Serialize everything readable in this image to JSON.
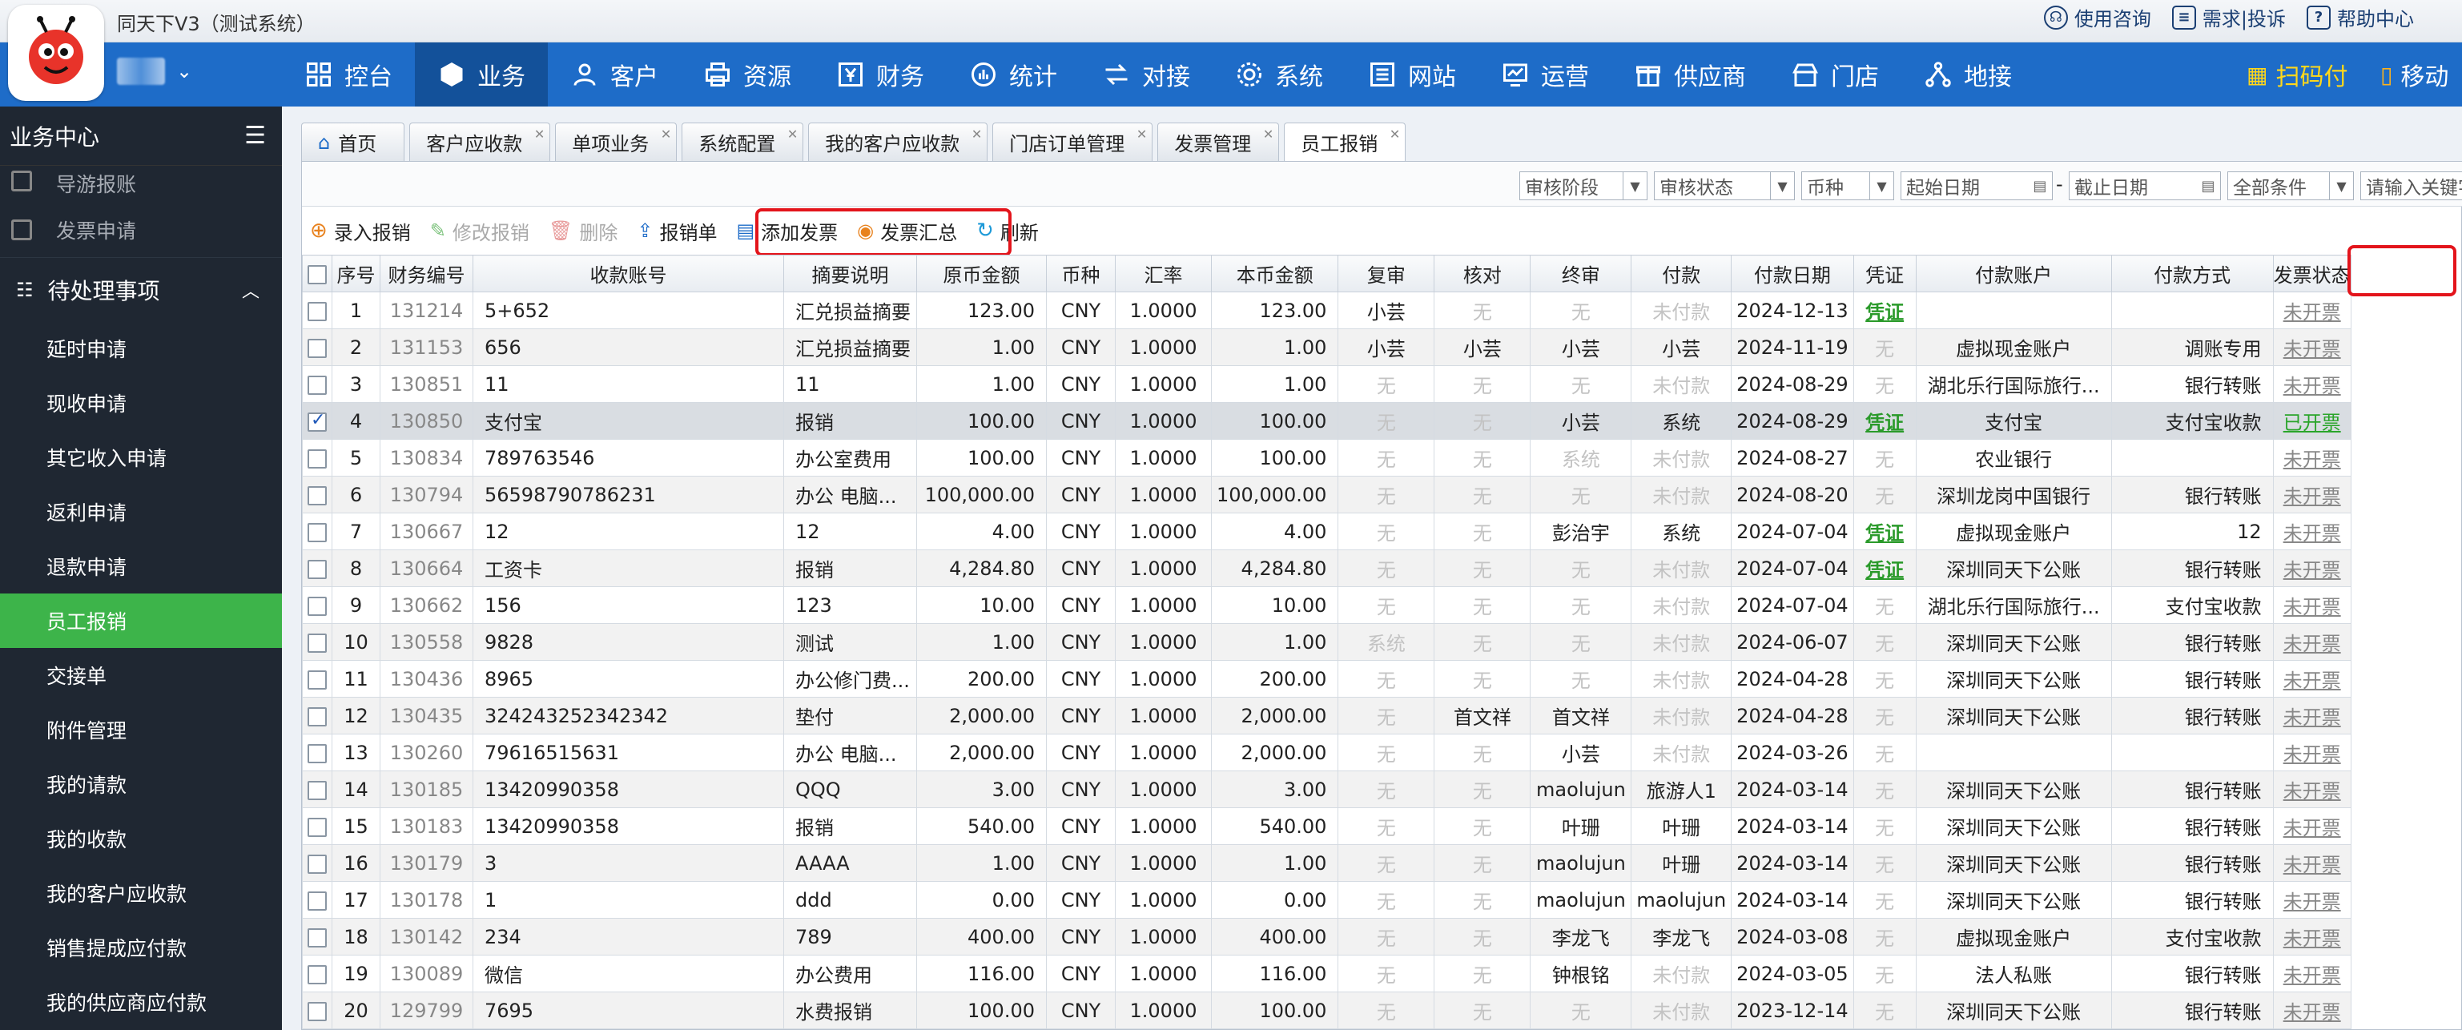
{
  "app_title": "同天下V3（测试系统）",
  "top_links": [
    "使用咨询",
    "需求|投诉",
    "帮助中心"
  ],
  "nav": [
    "控台",
    "业务",
    "客户",
    "资源",
    "财务",
    "统计",
    "对接",
    "系统",
    "网站",
    "运营",
    "供应商",
    "门店",
    "地接"
  ],
  "nav_active": "业务",
  "scan_label": "扫码付",
  "mobile_label": "移动",
  "sidebar": {
    "title": "业务中心",
    "top_items": [
      "导游报账",
      "发票申请"
    ],
    "group": "待处理事项",
    "sub_items": [
      "延时申请",
      "现收申请",
      "其它收入申请",
      "返利申请",
      "退款申请",
      "员工报销",
      "交接单",
      "附件管理",
      "我的请款",
      "我的收款",
      "我的客户应收款",
      "销售提成应付款",
      "我的供应商应付款"
    ],
    "active": "员工报销"
  },
  "tabs": [
    "首页",
    "客户应收款",
    "单项业务",
    "系统配置",
    "我的客户应收款",
    "门店订单管理",
    "发票管理",
    "员工报销"
  ],
  "active_tab": "员工报销",
  "filters": {
    "stage": "审核阶段",
    "status": "审核状态",
    "currency": "币种",
    "start_date": "起始日期",
    "dash": "-",
    "end_date": "截止日期",
    "all": "全部条件",
    "keyword": "请输入关键字"
  },
  "toolbar": [
    "录入报销",
    "修改报销",
    "删除",
    "报销单",
    "添加发票",
    "发票汇总",
    "刷新"
  ],
  "columns": [
    "序号",
    "财务编号",
    "收款账号",
    "摘要说明",
    "原币金额",
    "币种",
    "汇率",
    "本币金额",
    "复审",
    "核对",
    "终审",
    "付款",
    "付款日期",
    "凭证",
    "付款账户",
    "付款方式",
    "发票状态"
  ],
  "rows": [
    [
      "1",
      "131214",
      "5+652",
      "汇兑损益摘要",
      "123.00",
      "CNY",
      "1.0000",
      "123.00",
      "小芸",
      "无",
      "无",
      "未付款",
      "2024-12-13",
      "凭证",
      "",
      "",
      "未开票"
    ],
    [
      "2",
      "131153",
      "656",
      "汇兑损益摘要",
      "1.00",
      "CNY",
      "1.0000",
      "1.00",
      "小芸",
      "小芸",
      "小芸",
      "小芸",
      "2024-11-19",
      "无",
      "虚拟现金账户",
      "调账专用",
      "未开票"
    ],
    [
      "3",
      "130851",
      "11",
      "11",
      "1.00",
      "CNY",
      "1.0000",
      "1.00",
      "无",
      "无",
      "无",
      "未付款",
      "2024-08-29",
      "无",
      "湖北乐行国际旅行...",
      "银行转账",
      "未开票"
    ],
    [
      "4",
      "130850",
      "支付宝",
      "报销",
      "100.00",
      "CNY",
      "1.0000",
      "100.00",
      "无",
      "无",
      "小芸",
      "系统",
      "2024-08-29",
      "凭证",
      "支付宝",
      "支付宝收款",
      "已开票"
    ],
    [
      "5",
      "130834",
      "789763546",
      "办公室费用",
      "100.00",
      "CNY",
      "1.0000",
      "100.00",
      "无",
      "无",
      "系统",
      "未付款",
      "2024-08-27",
      "无",
      "农业银行",
      "",
      "未开票"
    ],
    [
      "6",
      "130794",
      "56598790786231",
      "办公 电脑...",
      "100,000.00",
      "CNY",
      "1.0000",
      "100,000.00",
      "无",
      "无",
      "无",
      "未付款",
      "2024-08-20",
      "无",
      "深圳龙岗中国银行",
      "银行转账",
      "未开票"
    ],
    [
      "7",
      "130667",
      "12",
      "12",
      "4.00",
      "CNY",
      "1.0000",
      "4.00",
      "无",
      "无",
      "彭治宇",
      "系统",
      "2024-07-04",
      "凭证",
      "虚拟现金账户",
      "12",
      "未开票"
    ],
    [
      "8",
      "130664",
      "工资卡",
      "报销",
      "4,284.80",
      "CNY",
      "1.0000",
      "4,284.80",
      "无",
      "无",
      "无",
      "未付款",
      "2024-07-04",
      "凭证",
      "深圳同天下公账",
      "银行转账",
      "未开票"
    ],
    [
      "9",
      "130662",
      "156",
      "123",
      "10.00",
      "CNY",
      "1.0000",
      "10.00",
      "无",
      "无",
      "无",
      "未付款",
      "2024-07-04",
      "无",
      "湖北乐行国际旅行...",
      "支付宝收款",
      "未开票"
    ],
    [
      "10",
      "130558",
      "9828",
      "测试",
      "1.00",
      "CNY",
      "1.0000",
      "1.00",
      "系统",
      "无",
      "无",
      "未付款",
      "2024-06-07",
      "无",
      "深圳同天下公账",
      "银行转账",
      "未开票"
    ],
    [
      "11",
      "130436",
      "8965",
      "办公修门费...",
      "200.00",
      "CNY",
      "1.0000",
      "200.00",
      "无",
      "无",
      "无",
      "未付款",
      "2024-04-28",
      "无",
      "深圳同天下公账",
      "银行转账",
      "未开票"
    ],
    [
      "12",
      "130435",
      "324243252342342",
      "垫付",
      "2,000.00",
      "CNY",
      "1.0000",
      "2,000.00",
      "无",
      "首文祥",
      "首文祥",
      "未付款",
      "2024-04-28",
      "无",
      "深圳同天下公账",
      "银行转账",
      "未开票"
    ],
    [
      "13",
      "130260",
      "79616515631",
      "办公 电脑...",
      "2,000.00",
      "CNY",
      "1.0000",
      "2,000.00",
      "无",
      "无",
      "小芸",
      "未付款",
      "2024-03-26",
      "无",
      "",
      "",
      "未开票"
    ],
    [
      "14",
      "130185",
      "13420990358",
      "QQQ",
      "3.00",
      "CNY",
      "1.0000",
      "3.00",
      "无",
      "无",
      "maolujun",
      "旅游人1",
      "2024-03-14",
      "无",
      "深圳同天下公账",
      "银行转账",
      "未开票"
    ],
    [
      "15",
      "130183",
      "13420990358",
      "报销",
      "540.00",
      "CNY",
      "1.0000",
      "540.00",
      "无",
      "无",
      "叶珊",
      "叶珊",
      "2024-03-14",
      "无",
      "深圳同天下公账",
      "银行转账",
      "未开票"
    ],
    [
      "16",
      "130179",
      "3",
      "AAAA",
      "1.00",
      "CNY",
      "1.0000",
      "1.00",
      "无",
      "无",
      "maolujun",
      "叶珊",
      "2024-03-14",
      "无",
      "深圳同天下公账",
      "银行转账",
      "未开票"
    ],
    [
      "17",
      "130178",
      "1",
      "ddd",
      "0.00",
      "CNY",
      "1.0000",
      "0.00",
      "无",
      "无",
      "maolujun",
      "maolujun",
      "2024-03-14",
      "无",
      "深圳同天下公账",
      "银行转账",
      "未开票"
    ],
    [
      "18",
      "130142",
      "234",
      "789",
      "400.00",
      "CNY",
      "1.0000",
      "400.00",
      "无",
      "无",
      "李龙飞",
      "李龙飞",
      "2024-03-08",
      "无",
      "虚拟现金账户",
      "支付宝收款",
      "未开票"
    ],
    [
      "19",
      "130089",
      "微信",
      "办公费用",
      "116.00",
      "CNY",
      "1.0000",
      "116.00",
      "无",
      "无",
      "钟根铭",
      "未付款",
      "2024-03-05",
      "无",
      "法人私账",
      "银行转账",
      "未开票"
    ],
    [
      "20",
      "129799",
      "7695",
      "水费报销",
      "100.00",
      "CNY",
      "1.0000",
      "100.00",
      "无",
      "无",
      "无",
      "未付款",
      "2023-12-14",
      "无",
      "深圳同天下公账",
      "银行转账",
      "未开票"
    ]
  ],
  "selected_row": 4,
  "colors": {
    "nav": "#1e6cc8",
    "sidebar": "#1f2732",
    "active_green": "#3db44a",
    "highlight": "#e3141b"
  }
}
